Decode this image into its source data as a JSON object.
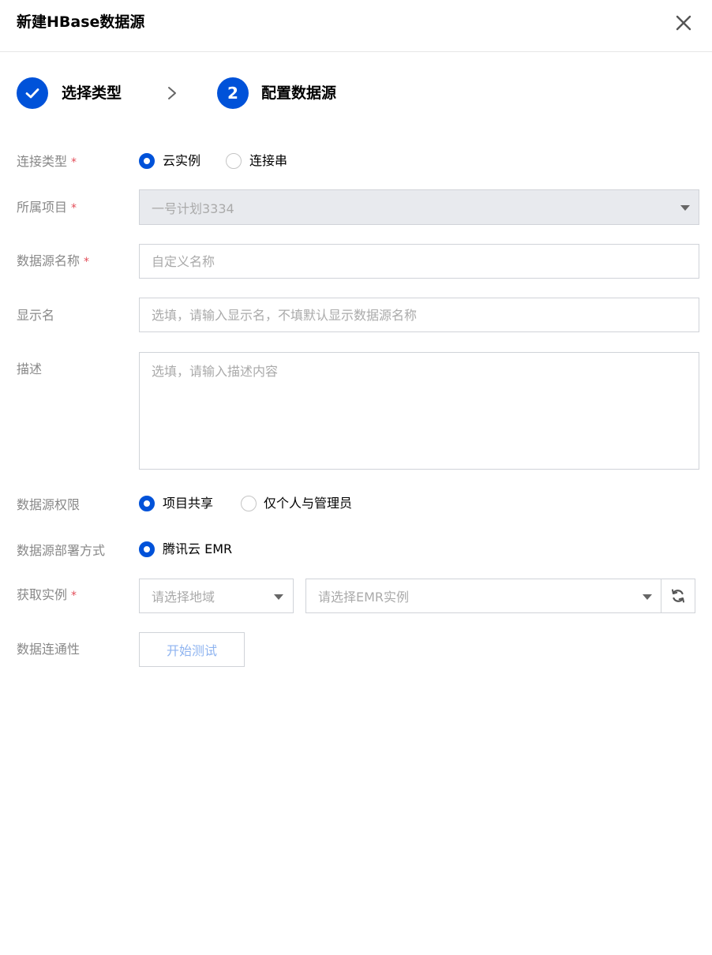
{
  "dialog": {
    "title": "新建HBase数据源"
  },
  "steps": [
    {
      "label": "选择类型",
      "number": "",
      "status": "done"
    },
    {
      "label": "配置数据源",
      "number": "2",
      "status": "active"
    }
  ],
  "form": {
    "required_mark": "*",
    "connection_type": {
      "label": "连接类型",
      "options": [
        "云实例",
        "连接串"
      ],
      "selected": "云实例"
    },
    "project": {
      "label": "所属项目",
      "value": "一号计划3334"
    },
    "datasource_name": {
      "label": "数据源名称",
      "placeholder": "自定义名称"
    },
    "display_name": {
      "label": "显示名",
      "placeholder": "选填，请输入显示名，不填默认显示数据源名称"
    },
    "description": {
      "label": "描述",
      "placeholder": "选填，请输入描述内容"
    },
    "permission": {
      "label": "数据源权限",
      "options": [
        "项目共享",
        "仅个人与管理员"
      ],
      "selected": "项目共享"
    },
    "deploy_mode": {
      "label": "数据源部署方式",
      "options": [
        "腾讯云 EMR"
      ],
      "selected": "腾讯云 EMR"
    },
    "instance": {
      "label": "获取实例",
      "region_placeholder": "请选择地域",
      "instance_placeholder": "请选择EMR实例"
    },
    "connectivity": {
      "label": "数据连通性",
      "button": "开始测试"
    }
  },
  "colors": {
    "primary": "#0052d9",
    "required": "#e34d59"
  }
}
